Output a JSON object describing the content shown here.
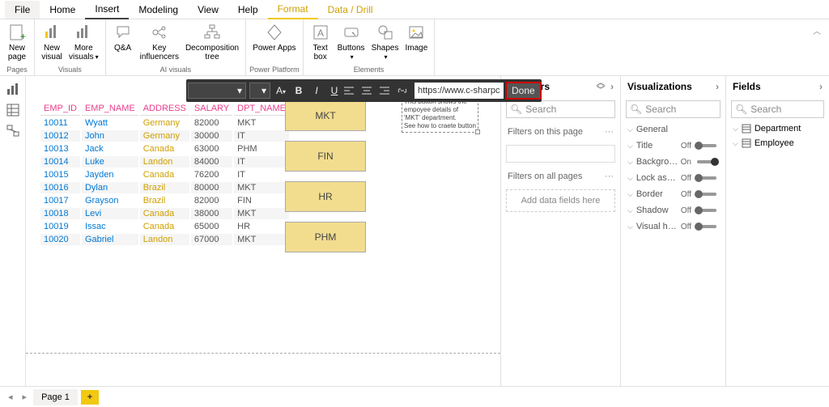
{
  "ribbon_tabs": {
    "file": "File",
    "home": "Home",
    "insert": "Insert",
    "modeling": "Modeling",
    "view": "View",
    "help": "Help",
    "format": "Format",
    "data_drill": "Data / Drill"
  },
  "ribbon_groups": {
    "pages": {
      "label": "Pages",
      "new_page": "New\npage"
    },
    "visuals": {
      "label": "Visuals",
      "new_visual": "New\nvisual",
      "more_visuals": "More\nvisuals"
    },
    "ai": {
      "label": "AI visuals",
      "qa": "Q&A",
      "key_inf": "Key\ninfluencers",
      "decomp": "Decomposition\ntree"
    },
    "pp": {
      "label": "Power Platform",
      "power_apps": "Power Apps"
    },
    "elements": {
      "label": "Elements",
      "text_box": "Text\nbox",
      "buttons": "Buttons",
      "shapes": "Shapes",
      "image": "Image"
    }
  },
  "table": {
    "headers": [
      "EMP_ID",
      "EMP_NAME",
      "ADDRESS",
      "SALARY",
      "DPT_NAME"
    ],
    "rows": [
      [
        "10011",
        "Wyatt",
        "Germany",
        "82000",
        "MKT"
      ],
      [
        "10012",
        "John",
        "Germany",
        "30000",
        "IT"
      ],
      [
        "10013",
        "Jack",
        "Canada",
        "63000",
        "PHM"
      ],
      [
        "10014",
        "Luke",
        "Landon",
        "84000",
        "IT"
      ],
      [
        "10015",
        "Jayden",
        "Canada",
        "76200",
        "IT"
      ],
      [
        "10016",
        "Dylan",
        "Brazil",
        "80000",
        "MKT"
      ],
      [
        "10017",
        "Grayson",
        "Brazil",
        "82000",
        "FIN"
      ],
      [
        "10018",
        "Levi",
        "Canada",
        "38000",
        "MKT"
      ],
      [
        "10019",
        "Issac",
        "Canada",
        "65000",
        "HR"
      ],
      [
        "10020",
        "Gabriel",
        "Landon",
        "67000",
        "MKT"
      ]
    ]
  },
  "buttons": [
    "MKT",
    "FIN",
    "HR",
    "PHM"
  ],
  "textbox": "This button shows the empoyee details of 'MKT' department.\nSee how to craete button",
  "format_bar": {
    "url": "https://www.c-sharpcorr",
    "done": "Done"
  },
  "filters": {
    "title": "Filters",
    "search": "Search",
    "on_page": "Filters on this page",
    "on_all": "Filters on all pages",
    "add_here": "Add data fields here"
  },
  "vis": {
    "title": "Visualizations",
    "search": "Search",
    "groups": [
      {
        "name": "General",
        "state": null
      },
      {
        "name": "Title",
        "state": "Off"
      },
      {
        "name": "Backgrou…",
        "state": "On"
      },
      {
        "name": "Lock aspe…",
        "state": "Off"
      },
      {
        "name": "Border",
        "state": "Off"
      },
      {
        "name": "Shadow",
        "state": "Off"
      },
      {
        "name": "Visual he…",
        "state": "Off"
      }
    ]
  },
  "fields": {
    "title": "Fields",
    "search": "Search",
    "tables": [
      "Department",
      "Employee"
    ]
  },
  "footer": {
    "page": "Page 1"
  }
}
